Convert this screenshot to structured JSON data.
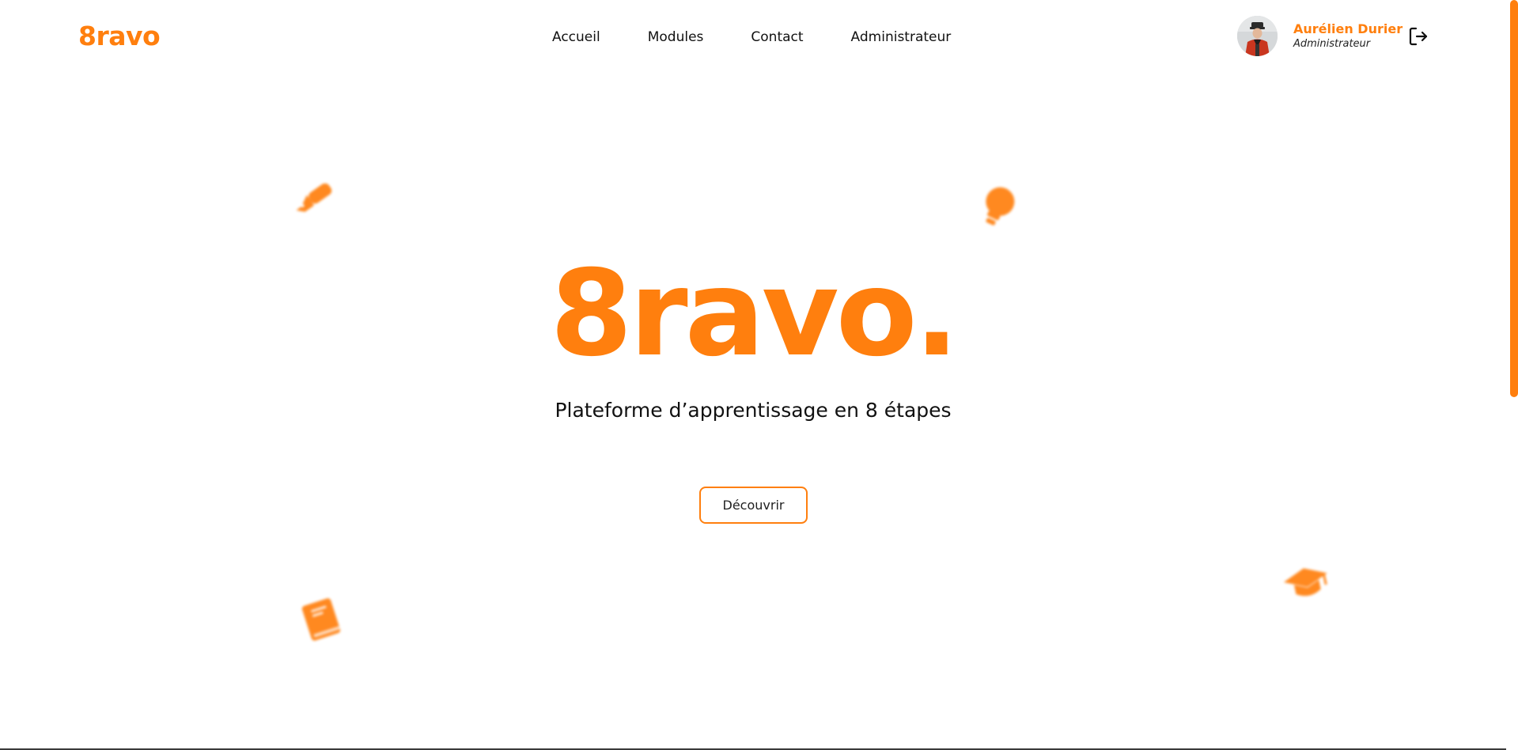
{
  "colors": {
    "accent": "#FF7F0E",
    "text": "#111111"
  },
  "header": {
    "logo": "8ravo",
    "nav": [
      {
        "label": "Accueil"
      },
      {
        "label": "Modules"
      },
      {
        "label": "Contact"
      },
      {
        "label": "Administrateur"
      }
    ],
    "user": {
      "name": "Aurélien Durier",
      "role": "Administrateur",
      "avatar_icon": "user-photo"
    },
    "logout_icon": "logout-icon"
  },
  "hero": {
    "title": "8ravo.",
    "subtitle": "Plateforme d’apprentissage en 8 étapes",
    "cta_label": "Découvrir"
  },
  "decorations": [
    {
      "icon": "pen-nib-icon"
    },
    {
      "icon": "lightbulb-icon"
    },
    {
      "icon": "book-icon"
    },
    {
      "icon": "graduation-cap-icon"
    }
  ]
}
